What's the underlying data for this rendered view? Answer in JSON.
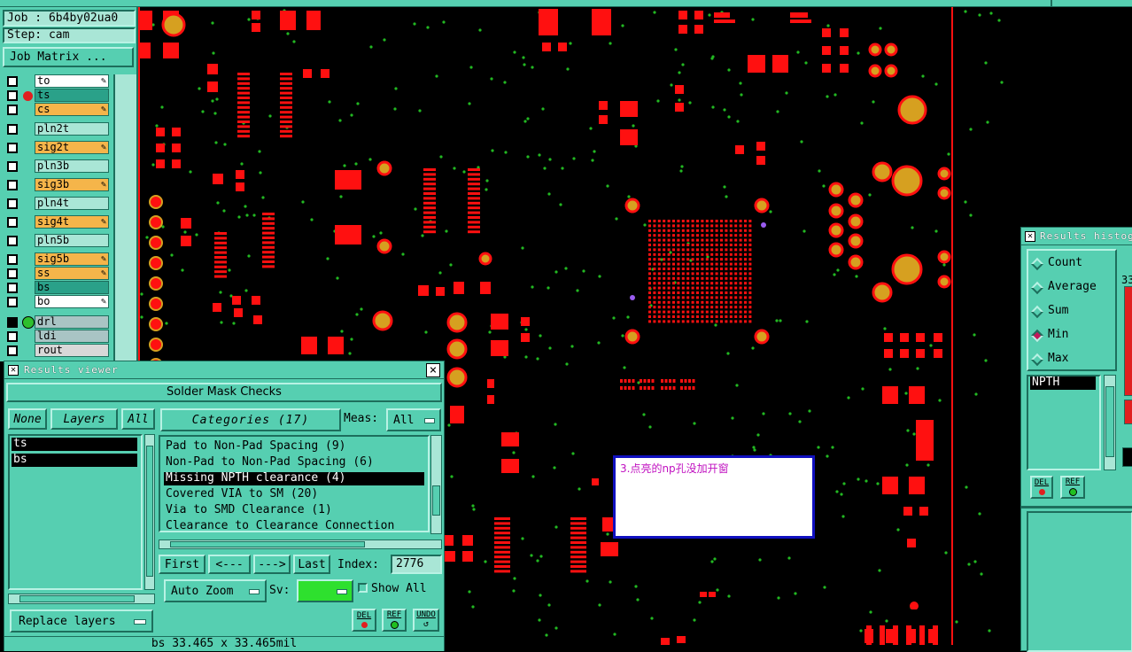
{
  "job_panel": {
    "job_label": "Job : 6b4by02ua0",
    "step_label": "Step: cam",
    "job_matrix_button": "Job Matrix ..."
  },
  "layers": [
    {
      "name": "to",
      "bg": "#ffffff",
      "pen": true
    },
    {
      "name": "ts",
      "bg": "#2aa189",
      "pen": false,
      "active": true
    },
    {
      "name": "cs",
      "bg": "#f5b54a",
      "pen": true
    },
    {
      "name": "pln2t",
      "bg": "#a9e6d6",
      "pen": false
    },
    {
      "name": "sig2t",
      "bg": "#f5b54a",
      "pen": true
    },
    {
      "name": "pln3b",
      "bg": "#a9e6d6",
      "pen": false
    },
    {
      "name": "sig3b",
      "bg": "#f5b54a",
      "pen": true
    },
    {
      "name": "pln4t",
      "bg": "#a9e6d6",
      "pen": false
    },
    {
      "name": "sig4t",
      "bg": "#f5b54a",
      "pen": true
    },
    {
      "name": "pln5b",
      "bg": "#a9e6d6",
      "pen": false
    },
    {
      "name": "sig5b",
      "bg": "#f5b54a",
      "pen": true
    },
    {
      "name": "ss",
      "bg": "#f5b54a",
      "pen": true
    },
    {
      "name": "bs",
      "bg": "#2aa189",
      "pen": false
    },
    {
      "name": "bo",
      "bg": "#ffffff",
      "pen": true
    },
    {
      "name": "drl",
      "bg": "#a9c4c4",
      "pen": false
    },
    {
      "name": "ldi",
      "bg": "#a9c4c4",
      "pen": false
    },
    {
      "name": "rout",
      "bg": "#d8d8d8",
      "pen": false
    }
  ],
  "results_viewer": {
    "title": "Results viewer",
    "close": "×",
    "header": "Solder Mask Checks",
    "none_btn": "None",
    "layers_btn": "Layers",
    "all_btn": "All",
    "categories_btn": "Categories (17)",
    "meas_label": "Meas:",
    "meas_value": "All",
    "layer_list": [
      "ts",
      "bs"
    ],
    "categories": [
      "Pad to Non-Pad Spacing (9)",
      "Non-Pad to Non-Pad Spacing (6)",
      "Missing NPTH clearance (4)",
      "Covered VIA to SM (20)",
      "Via to SMD Clearance (1)",
      "Clearance to Clearance Connection"
    ],
    "selected_category": 2,
    "first_btn": "First",
    "prev_btn": "<---",
    "next_btn": "--->",
    "last_btn": "Last",
    "index_label": "Index:",
    "index_value": "2776",
    "auto_zoom": "Auto Zoom",
    "sv_label": "Sv:",
    "show_all": "Show All",
    "replace_layers": "Replace layers",
    "del_btn": "DEL",
    "ref_btn": "REF",
    "undo_btn": "UNDO",
    "status": "bs 33.465 x 33.465mil"
  },
  "annotation": {
    "text": "3.点亮的np孔没加开窗"
  },
  "histogram": {
    "title": "Results histogr",
    "options": [
      "Count",
      "Average",
      "Sum",
      "Min",
      "Max"
    ],
    "selected": 3,
    "list": [
      "NPTH"
    ],
    "del_btn": "DEL",
    "ref_btn": "REF",
    "partial_value": "33"
  },
  "colors": {
    "panel": "#56cfb1",
    "pad": "#ff1010",
    "via": "#22b822",
    "copper": "#d6a020",
    "selection": "#000000"
  }
}
